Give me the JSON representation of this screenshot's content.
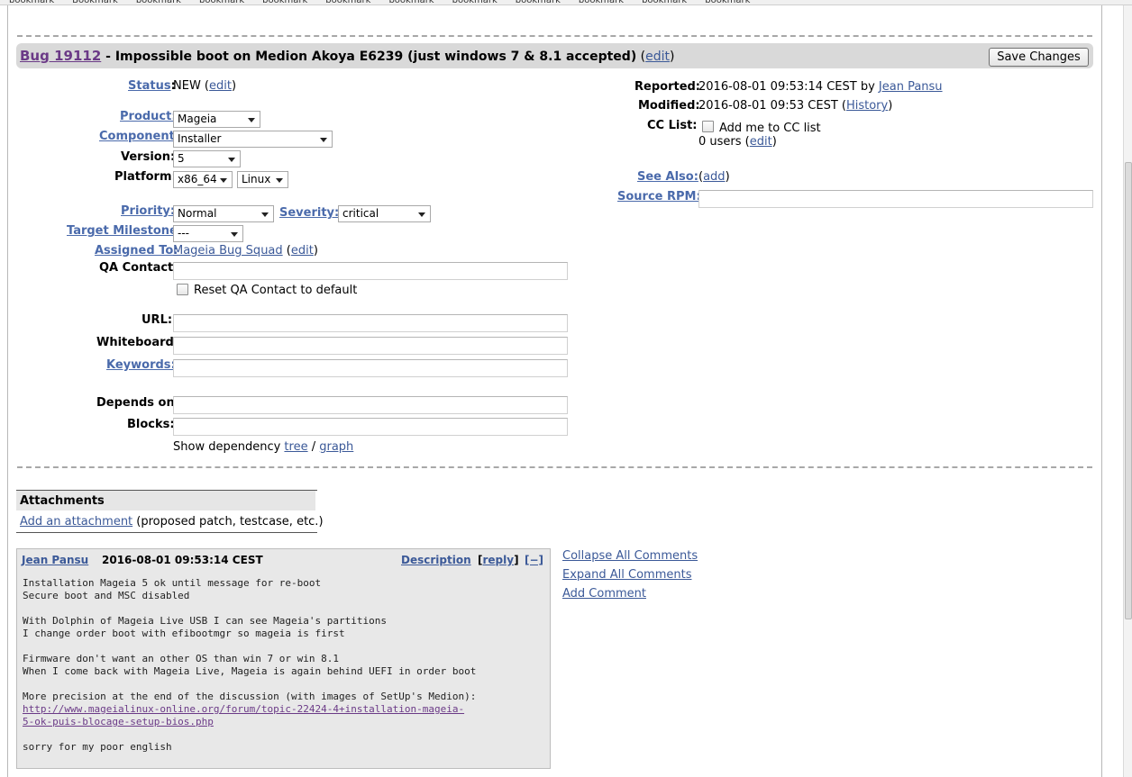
{
  "bookmarks": [
    "bookmark",
    "Bookmark",
    "bookmark",
    "bookmark",
    "bookmark",
    "bookmark",
    "bookmark",
    "bookmark",
    "bookmark",
    "bookmark",
    "bookmark",
    "bookmark"
  ],
  "header": {
    "bug_label": "Bug 19112",
    "title": " - Impossible boot on Medion Akoya E6239 (just windows 7 & 8.1 accepted)",
    "edit_open": " (",
    "edit": "edit",
    "edit_close": ")",
    "save_button": "Save Changes"
  },
  "left": {
    "status_label": "Status",
    "colon": ":",
    "status_value": "NEW",
    "status_edit": "edit",
    "product_label": "Product:",
    "product_value": "Mageia",
    "component_label": "Component:",
    "component_value": "Installer",
    "version_label": "Version:",
    "version_value": "5",
    "platform_label": "Platform:",
    "platform_arch": "x86_64",
    "platform_os": "Linux",
    "priority_label": "Priority:",
    "priority_value": "Normal",
    "severity_label": "Severity:",
    "severity_value": "critical",
    "milestone_label": "Target Milestone:",
    "milestone_value": "---",
    "assigned_label": "Assigned To:",
    "assigned_value": "Mageia Bug Squad",
    "assigned_edit": "edit",
    "qa_label": "QA Contact:",
    "qa_reset": "Reset QA Contact to default",
    "url_label": "URL:",
    "whiteboard_label": "Whiteboard:",
    "keywords_label": "Keywords:",
    "depends_label": "Depends on:",
    "blocks_label": "Blocks:",
    "show_dep": "Show dependency ",
    "dep_tree": "tree",
    "dep_sep": " / ",
    "dep_graph": "graph"
  },
  "right": {
    "reported_label": "Reported:",
    "reported_value": "2016-08-01 09:53:14 CEST by ",
    "reported_by": "Jean Pansu",
    "modified_label": "Modified:",
    "modified_value": "2016-08-01 09:53 CEST (",
    "history": "History",
    "modified_close": ")",
    "cc_label": "CC List:",
    "cc_add": "Add me to CC list",
    "cc_users": "0 users (",
    "cc_edit": "edit",
    "cc_close": ")",
    "see_also_label": "See Also:",
    "see_also_add": "add",
    "source_rpm_label": "Source RPM:"
  },
  "attachments": {
    "title": "Attachments",
    "add_link": "Add an attachment",
    "add_note": " (proposed patch, testcase, etc.)"
  },
  "comment": {
    "author": "Jean Pansu",
    "date": "2016-08-01 09:53:14 CEST",
    "description": "Description",
    "reply_open": "[",
    "reply": "reply",
    "reply_close": "]",
    "collapse": "[−]",
    "body_lines": [
      "Installation Mageia 5 ok until message for re-boot",
      "Secure boot and MSC disabled",
      "",
      "With Dolphin of Mageia Live USB I can see Mageia's partitions",
      "I change order boot with efibootmgr so mageia is first",
      "",
      "Firmware don't want an other OS than win 7 or win 8.1",
      "When I come back with Mageia Live, Mageia is again behind UEFI in order boot",
      "",
      "More precision at the end of the discussion (with images of SetUp's Medion):"
    ],
    "link_line1": "http://www.mageialinux-online.org/forum/topic-22424-4+installation-mageia-",
    "link_line2": "5-ok-puis-blocage-setup-bios.php",
    "closing": "sorry for my poor english"
  },
  "comment_actions": {
    "collapse_all": "Collapse All Comments",
    "expand_all": "Expand All Comments",
    "add_comment": "Add Comment"
  }
}
